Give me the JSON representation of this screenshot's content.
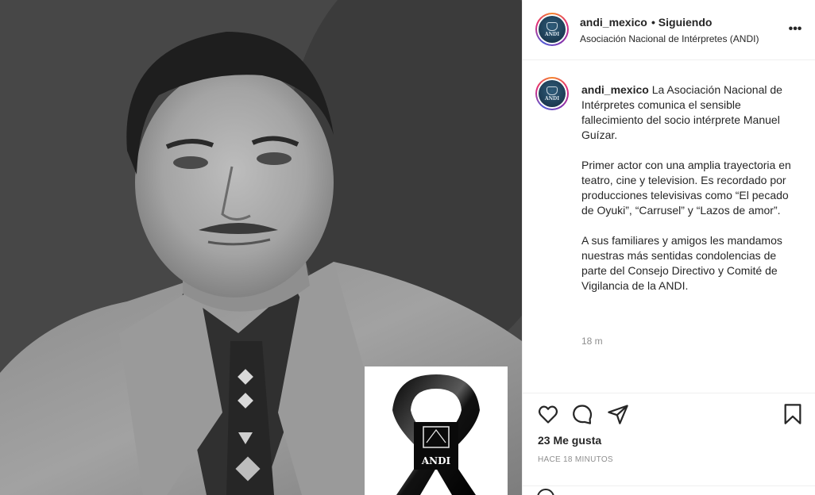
{
  "post": {
    "image_alt": "Fotografía en blanco y negro de Manuel Guízar con listón de luto de la ANDI",
    "ribbon_logo_text": "ANDI"
  },
  "header": {
    "avatar_text": "ANDI",
    "username": "andi_mexico",
    "follow_status": "• Siguiendo",
    "subtitle": "Asociación Nacional de Intérpretes (ANDI)"
  },
  "caption": {
    "avatar_text": "ANDI",
    "username": "andi_mexico",
    "paragraph1": "La Asociación Nacional de Intérpretes comunica el sensible fallecimiento del socio intérprete Manuel Guízar.",
    "paragraph2": "Primer actor con una amplia trayectoria en teatro, cine y television. Es recordado por producciones televisivas como “El pecado de Oyuki”, “Carrusel” y “Lazos de amor”.",
    "paragraph3": "A sus familiares y amigos les mandamos nuestras más sentidas condolencias de parte del Consejo Directivo y Comité de Vigilancia de la ANDI.",
    "time": "18 m"
  },
  "actions": {
    "icons": [
      "heart-icon",
      "comment-icon",
      "share-icon",
      "bookmark-icon"
    ],
    "likes": "23 Me gusta",
    "posted_ago": "HACE 18 MINUTOS"
  },
  "colors": {
    "text": "#262626",
    "secondary": "#8e8e8e",
    "border": "#efefef"
  }
}
